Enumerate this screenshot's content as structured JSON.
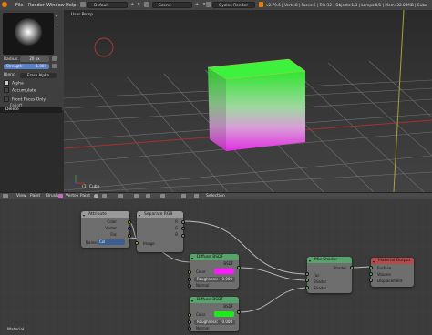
{
  "topbar": {
    "menus": [
      "File",
      "Render",
      "Window",
      "Help"
    ],
    "layout": "Default",
    "scene": "Scene",
    "engine": "Cycles Render",
    "stats": "v2.79.6 | Verts:8 | Faces:6 | Tris:12 | Objects:1/3 | Lamps:0/1 | Mem: 32.0 MiB | Cube"
  },
  "tool_panel": {
    "radius_label": "Radius:",
    "radius_value": "20 px",
    "strength_label": "Strength:",
    "strength_value": "1.000",
    "blend_label": "Blend",
    "blend_value": "Erase Alpha",
    "alpha_label": "Alpha",
    "accumulate_label": "Accumulate",
    "front_faces_label": "Front Faces Only",
    "falloff_label": "Falloff",
    "delete_label": "Delete"
  },
  "viewport": {
    "view_label": "User Persp",
    "object_label": "(1) Cube",
    "cube_top_color": "#2ee52e",
    "cube_bottom_color": "#e22ee2"
  },
  "viewport_header": {
    "items": [
      "View",
      "Paint",
      "Brush",
      "Vertex Paint"
    ],
    "selection": "Selection"
  },
  "node_editor": {
    "footer_label": "Material",
    "attribute": {
      "title": "Attribute",
      "outputs": [
        "Color",
        "Vector",
        "Fac"
      ],
      "name_label": "Name:",
      "name_value": "Col"
    },
    "separate_rgb": {
      "title": "Separate RGB",
      "outputs": [
        "R",
        "G",
        "B"
      ],
      "input": "Image"
    },
    "diffuse1": {
      "title": "Diffuse BSDF",
      "output": "BSDF",
      "color_label": "Color",
      "color_swatch": "#ff19ff",
      "roughness_label": "Roughness:",
      "roughness_value": "0.000",
      "normal_label": "Normal"
    },
    "diffuse2": {
      "title": "Diffuse BSDF",
      "output": "BSDF",
      "color_label": "Color",
      "color_swatch": "#1fe81f",
      "roughness_label": "Roughness:",
      "roughness_value": "0.000",
      "normal_label": "Normal"
    },
    "mix_shader": {
      "title": "Mix Shader",
      "output": "Shader",
      "inputs": [
        "Fac",
        "Shader",
        "Shader"
      ]
    },
    "material_output": {
      "title": "Material Output",
      "inputs": [
        "Surface",
        "Volume",
        "Displacement"
      ]
    }
  }
}
